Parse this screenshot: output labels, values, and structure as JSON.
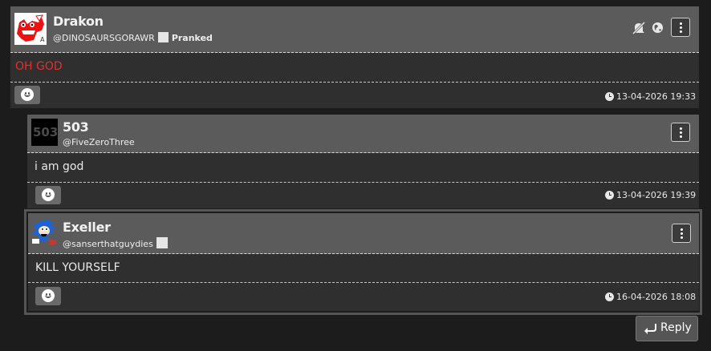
{
  "comments": [
    {
      "username": "Drakon",
      "handle": "@DINOSAURSGORAWR",
      "flag": "Pranked",
      "body": "OH GOD",
      "body_color": "#e53030",
      "timestamp": "13-04-2026 19:33",
      "header_icons": [
        "mute-icon",
        "globe-icon"
      ],
      "avatar_text": "",
      "avatar_icon": "red-cartoon-creature-avatar"
    },
    {
      "username": "503",
      "handle": "@FiveZeroThree",
      "body": "i am god",
      "timestamp": "13-04-2026 19:39",
      "avatar_text": "503"
    },
    {
      "username": "Exeller",
      "handle": "@sanserthatguydies",
      "body": "KILL YOURSELF",
      "timestamp": "16-04-2026 18:08",
      "avatar_icon": "blue-hedgehog-avatar"
    }
  ],
  "reply": {
    "label": "Reply",
    "icon": "reply-arrow-icon"
  },
  "colors": {
    "page_bg": "#1c1c1c",
    "card_bg": "#2f2f2f",
    "header_bg": "#5b5b5b",
    "highlight_border": "#555555"
  }
}
